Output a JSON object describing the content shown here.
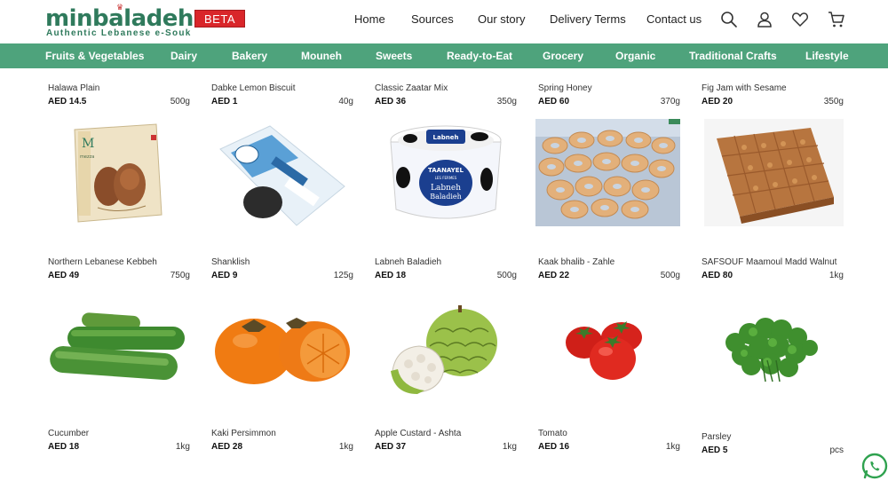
{
  "brand": {
    "name": "minbaladeh",
    "tagline": "Authentic Lebanese e-Souk",
    "badge": "BETA"
  },
  "colors": {
    "brand_green": "#2f7a5c",
    "category_bar": "#4ea37c",
    "badge_red": "#d9262a"
  },
  "topnav": [
    "Home",
    "Sources",
    "Our story",
    "Delivery Terms",
    "Contact us"
  ],
  "header_icons": [
    "search-icon",
    "user-icon",
    "heart-icon",
    "cart-icon"
  ],
  "categories": [
    "Fruits & Vegetables",
    "Dairy",
    "Bakery",
    "Mouneh",
    "Sweets",
    "Ready-to-Eat",
    "Grocery",
    "Organic",
    "Traditional Crafts",
    "Lifestyle"
  ],
  "products_top": [
    {
      "name": "Halawa Plain",
      "price": "AED 14.5",
      "weight": "500g"
    },
    {
      "name": "Dabke Lemon Biscuit",
      "price": "AED 1",
      "weight": "40g"
    },
    {
      "name": "Classic Zaatar Mix",
      "price": "AED 36",
      "weight": "350g"
    },
    {
      "name": "Spring Honey",
      "price": "AED 60",
      "weight": "370g"
    },
    {
      "name": "Fig Jam with Sesame",
      "price": "AED 20",
      "weight": "350g"
    }
  ],
  "products_middle": [
    {
      "name": "Northern Lebanese Kebbeh",
      "price": "AED 49",
      "weight": "750g",
      "image": "kebbeh-box-image"
    },
    {
      "name": "Shanklish",
      "price": "AED 9",
      "weight": "125g",
      "image": "shanklish-pack-image"
    },
    {
      "name": "Labneh Baladieh",
      "price": "AED 18",
      "weight": "500g",
      "image": "labneh-tub-image",
      "image_text": [
        "TAANAYEL",
        "LES FERMES",
        "Labneh",
        "Baladieh"
      ]
    },
    {
      "name": "Kaak bhalib - Zahle",
      "price": "AED 22",
      "weight": "500g",
      "image": "kaak-bread-image"
    },
    {
      "name": "SAFSOUF Maamoul Madd Walnut",
      "price": "AED 80",
      "weight": "1kg",
      "image": "maamoul-tray-image"
    }
  ],
  "products_bottom": [
    {
      "name": "Cucumber",
      "price": "AED 18",
      "weight": "1kg",
      "image": "cucumber-image"
    },
    {
      "name": "Kaki Persimmon",
      "price": "AED 28",
      "weight": "1kg",
      "image": "persimmon-image"
    },
    {
      "name": "Apple Custard - Ashta",
      "price": "AED 37",
      "weight": "1kg",
      "image": "custard-apple-image"
    },
    {
      "name": "Tomato",
      "price": "AED 16",
      "weight": "1kg",
      "image": "tomato-image"
    },
    {
      "name": "Parsley",
      "price": "AED 5",
      "weight": "pcs",
      "image": "parsley-image"
    }
  ],
  "floating": {
    "chat": "whatsapp-icon"
  }
}
